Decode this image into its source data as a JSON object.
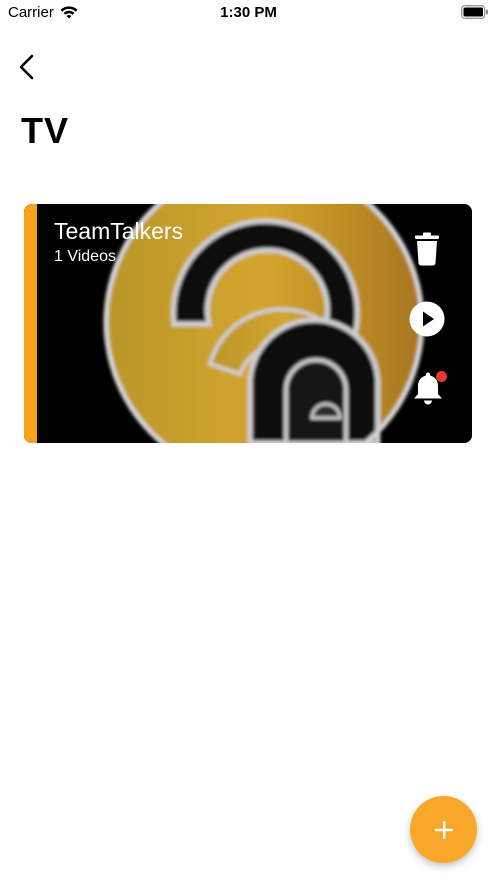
{
  "status_bar": {
    "carrier": "Carrier",
    "time": "1:30 PM",
    "wifi_icon": "wifi-icon",
    "battery_icon": "battery-icon"
  },
  "nav": {
    "back_icon": "chevron-left-icon",
    "title": "TV"
  },
  "channels": [
    {
      "name": "TeamTalkers",
      "video_count": "1 Videos",
      "actions": [
        "trash-icon",
        "play-circle-icon",
        "bell-icon"
      ],
      "has_notification": true
    }
  ],
  "fab": {
    "icon": "plus-icon"
  },
  "colors": {
    "accent": "#f7a21b",
    "fab": "#f9a72b",
    "notification": "#e53935",
    "card_bg": "#000000",
    "gold": "#c99a2e"
  }
}
